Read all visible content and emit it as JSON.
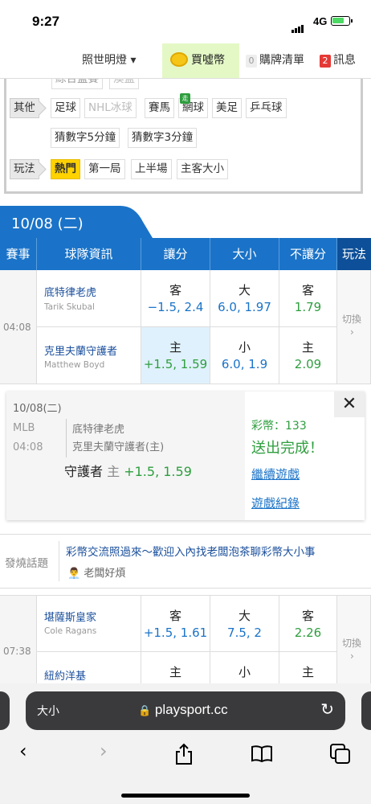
{
  "status": {
    "time": "9:27",
    "network": "4G"
  },
  "topbar": {
    "lamp": "照世明燈 ▾",
    "buy": "買噓幣",
    "cart_count": "0",
    "cart": "購牌清單",
    "msg_count": "2",
    "msg": "訊息"
  },
  "filter": {
    "partial": [
      "綜合監賽",
      "澳監"
    ],
    "other_label": "其他",
    "other": [
      "足球",
      "NHL冰球",
      "賽馬",
      "網球",
      "美足",
      "乒乓球"
    ],
    "walk_tag": "走",
    "numbers": [
      "猜數字5分鐘",
      "猜數字3分鐘"
    ],
    "play_label": "玩法",
    "play": [
      "熱門",
      "第一局",
      "上半場",
      "主客大小"
    ]
  },
  "date": "10/08 (二)",
  "header": {
    "event": "賽事",
    "team": "球隊資訊",
    "spread": "讓分",
    "total": "大小",
    "ml": "不讓分",
    "play": "玩法"
  },
  "game1": {
    "time": "04:08",
    "switch": "切換",
    "away": {
      "team": "底特律老虎",
      "pitcher": "Tarik Skubal",
      "spread_label": "客",
      "spread": "−1.5, 2.4",
      "total_label": "大",
      "total": "6.0, 1.97",
      "ml_label": "客",
      "ml": "1.79"
    },
    "home": {
      "team": "克里夫蘭守護者",
      "pitcher": "Matthew Boyd",
      "spread_label": "主",
      "spread": "+1.5, 1.59",
      "total_label": "小",
      "total": "6.0, 1.9",
      "ml_label": "主",
      "ml": "2.09"
    }
  },
  "card": {
    "date": "10/08(二)",
    "league": "MLB",
    "time": "04:08",
    "away": "底特律老虎",
    "home": "克里夫蘭守護者(主)",
    "pick_team": "守護者",
    "pick_side": "主",
    "pick_odds": "+1.5, 1.59",
    "coins": "彩幣：133",
    "done": "送出完成！",
    "continue": "繼續遊戲",
    "record": "遊戲紀錄",
    "close": "✕"
  },
  "topic": {
    "label": "發燒話題",
    "title": "彩幣交流照過來～歡迎入內找老闆泡茶聊彩幣大小事",
    "author": "老闆好煩"
  },
  "game2": {
    "time": "07:38",
    "switch": "切換",
    "away": {
      "team": "堪薩斯皇家",
      "pitcher": "Cole Ragans",
      "spread_label": "客",
      "spread": "+1.5, 1.61",
      "total_label": "大",
      "total": "7.5, 2",
      "ml_label": "客",
      "ml": "2.26"
    },
    "home": {
      "team": "紐約洋基",
      "pitcher": "",
      "spread_label": "主",
      "total_label": "小",
      "ml_label": "主"
    }
  },
  "browser": {
    "aa": "大小",
    "domain": "playsport.cc"
  }
}
